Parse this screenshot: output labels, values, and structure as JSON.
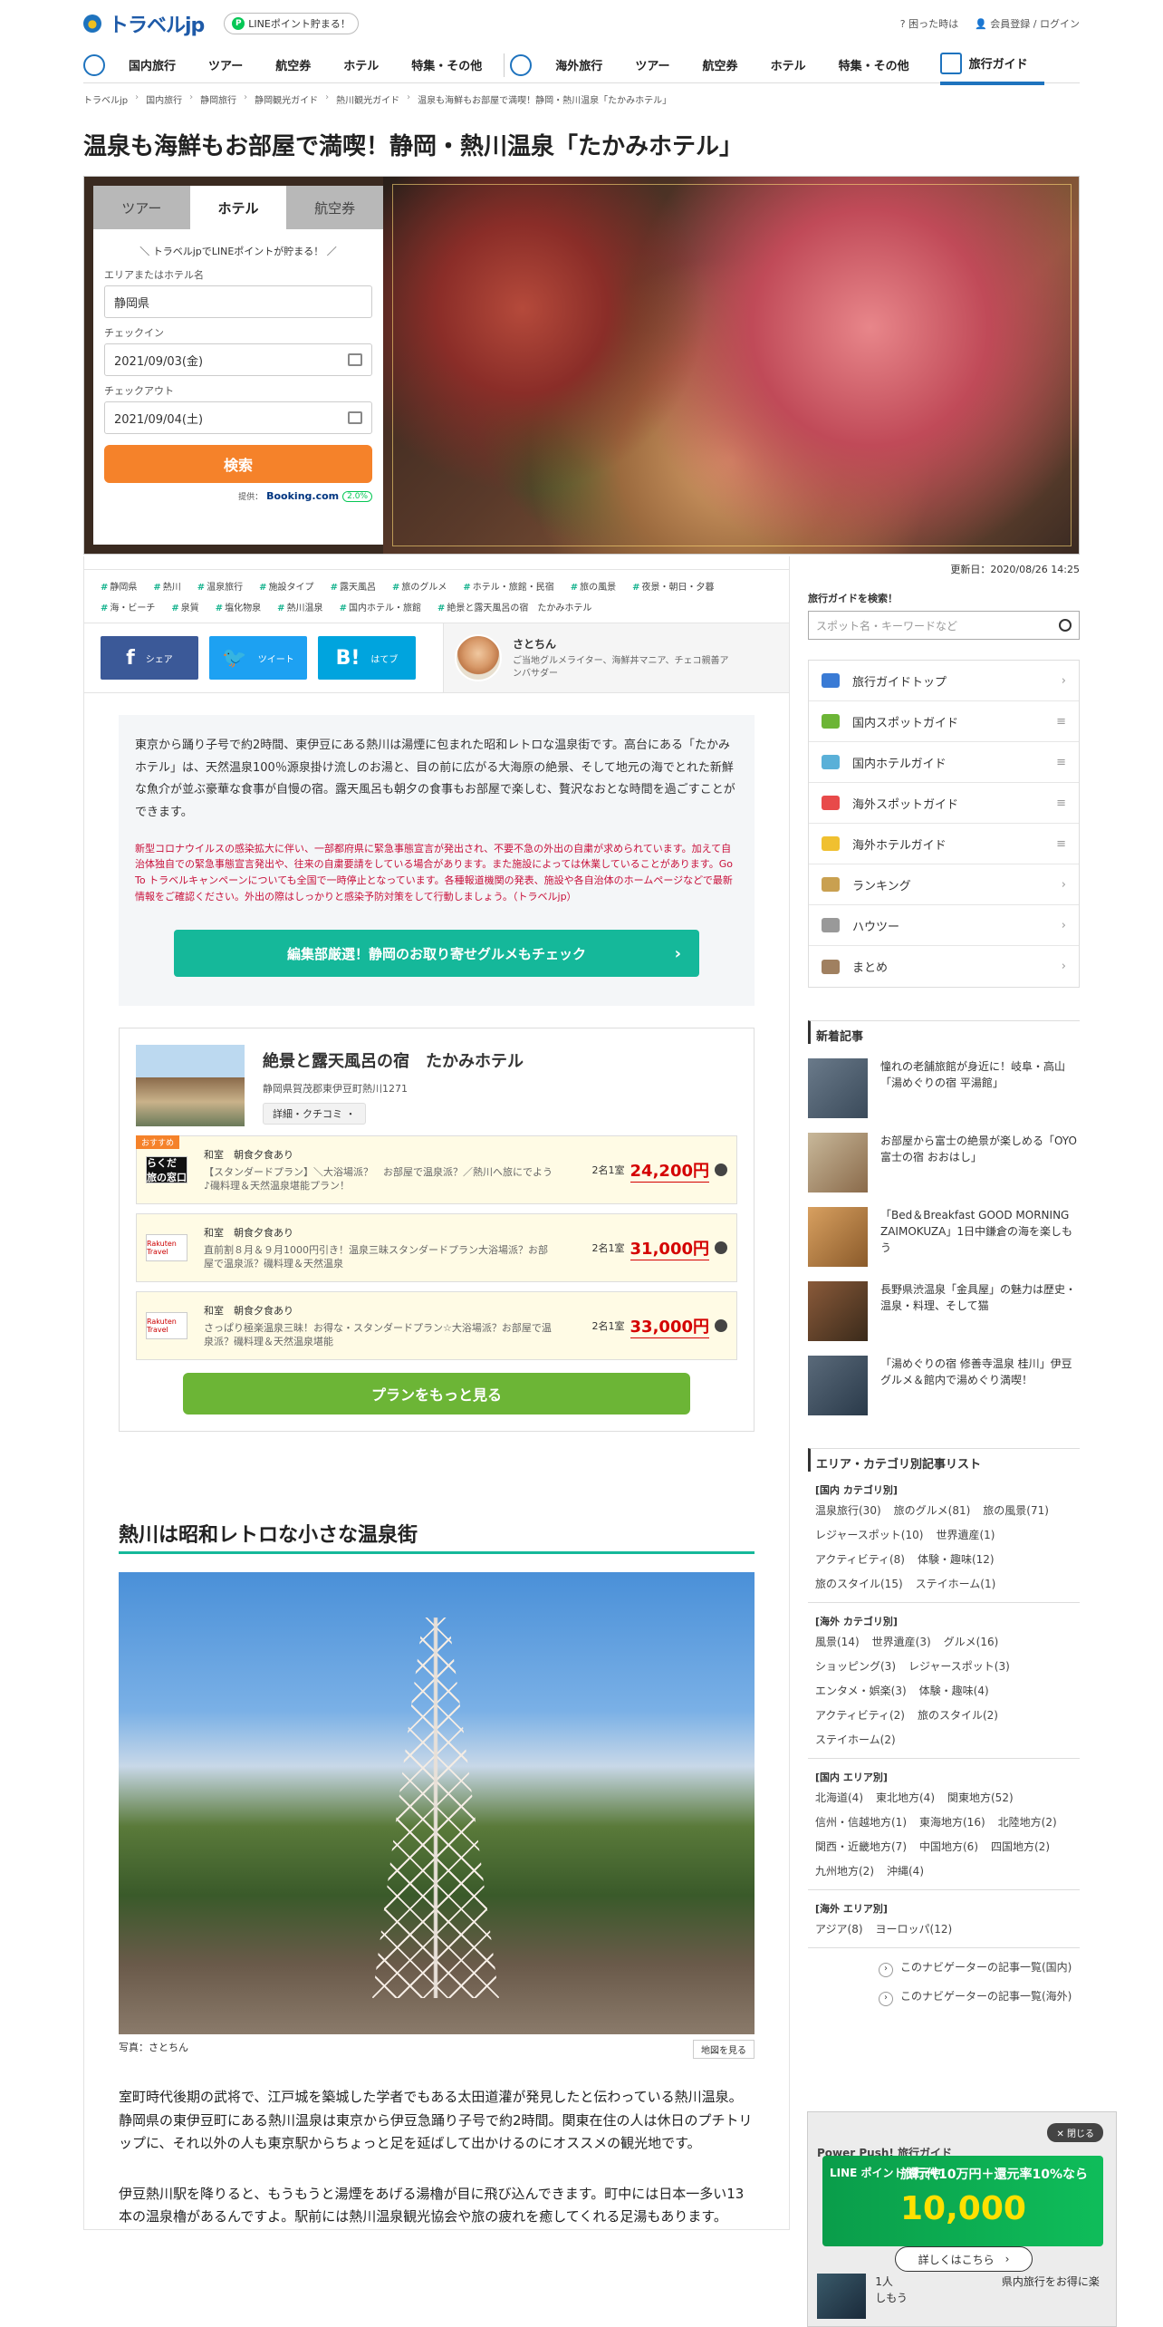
{
  "header": {
    "logo": "トラベルjp",
    "line_pill": "LINEポイント貯まる！",
    "help": "困った時は",
    "login": "会員登録 / ログイン"
  },
  "nav": {
    "domestic": [
      "国内旅行",
      "ツアー",
      "航空券",
      "ホテル",
      "特集・その他"
    ],
    "overseas": [
      "海外旅行",
      "ツアー",
      "航空券",
      "ホテル",
      "特集・その他"
    ],
    "guide": "旅行ガイド"
  },
  "breadcrumb": [
    "トラベルjp",
    "国内旅行",
    "静岡旅行",
    "静岡観光ガイド",
    "熱川観光ガイド",
    "温泉も海鮮もお部屋で満喫！静岡・熱川温泉「たかみホテル」"
  ],
  "title": "温泉も海鮮もお部屋で満喫！静岡・熱川温泉「たかみホテル」",
  "search_panel": {
    "tabs": [
      "ツアー",
      "ホテル",
      "航空券"
    ],
    "line_notice": "＼ トラベルjpでLINEポイントが貯まる！ ／",
    "area_label": "エリアまたはホテル名",
    "area_value": "静岡県",
    "checkin_label": "チェックイン",
    "checkin_value": "2021/09/03(金)",
    "checkout_label": "チェックアウト",
    "checkout_value": "2021/09/04(土)",
    "search_button": "検索",
    "provider": "提供：",
    "provider_name": "Booking.com",
    "point_rate": "2.0%"
  },
  "updated": "更新日：2020/08/26 14:25",
  "tags": [
    "静岡県",
    "熱川",
    "温泉旅行",
    "施設タイプ",
    "露天風呂",
    "旅のグルメ",
    "ホテル・旅館・民宿",
    "旅の風景",
    "夜景・朝日・夕暮",
    "海・ビーチ",
    "泉質",
    "塩化物泉",
    "熱川温泉",
    "国内ホテル・旅館",
    "絶景と露天風呂の宿　たかみホテル"
  ],
  "share": {
    "fb": "シェア",
    "tw": "ツイート",
    "hb": "はてブ",
    "author_name": "さとちん",
    "author_desc": "ご当地グルメライター、海鮮丼マニア、チェコ親善アンバサダー"
  },
  "lead": {
    "text": "東京から踊り子号で約2時間、東伊豆にある熱川は湯煙に包まれた昭和レトロな温泉街です。高台にある「たかみホテル」は、天然温泉100％源泉掛け流しのお湯と、目の前に広がる大海原の絶景、そして地元の海でとれた新鮮な魚介が並ぶ豪華な食事が自慢の宿。露天風呂も朝夕の食事もお部屋で楽しむ、贅沢なおとな時間を過ごすことができます。",
    "warning": "新型コロナウイルスの感染拡大に伴い、一部都府県に緊急事態宣言が発出され、不要不急の外出の自粛が求められています。加えて自治体独自での緊急事態宣言発出や、往来の自粛要請をしている場合があります。また施設によっては休業していることがあります。Go To トラベルキャンペーンについても全国で一時停止となっています。各種報道機関の発表、施設や各自治体のホームページなどで最新情報をご確認ください。外出の際はしっかりと感染予防対策をして行動しましょう。（トラベルjp）",
    "button": "編集部厳選！静岡のお取り寄せグルメもチェック"
  },
  "hotel": {
    "name": "絶景と露天風呂の宿　たかみホテル",
    "address": "静岡県賀茂郡東伊豆町熱川1271",
    "detail_button": "詳細・クチコミ ・",
    "recommend": "おすすめ",
    "plans": [
      {
        "logo": "らくだ 旅の窓口",
        "type": "和室　朝食夕食あり",
        "desc": "【スタンダードプラン】＼大浴場派？　お部屋で温泉派？／熱川へ旅にでよう♪磯料理＆天然温泉堪能プラン！",
        "unit": "2名1室",
        "price": "24,200円"
      },
      {
        "logo": "Rakuten Travel",
        "type": "和室　朝食夕食あり",
        "desc": "直前割８月＆９月1000円引き！温泉三昧スタンダードプラン大浴場派？お部屋で温泉派？磯料理＆天然温泉",
        "unit": "2名1室",
        "price": "31,000円"
      },
      {
        "logo": "Rakuten Travel",
        "type": "和室　朝食夕食あり",
        "desc": "さっぱり極楽温泉三昧！お得な・スタンダードプラン☆大浴場派？お部屋で温泉派？磯料理＆天然温泉堪能",
        "unit": "2名1室",
        "price": "33,000円"
      }
    ],
    "more_button": "プランをもっと見る"
  },
  "section": {
    "heading": "熱川は昭和レトロな小さな温泉街",
    "photo_credit": "写真：さとちん",
    "map_button": "地図を見る",
    "p1": "室町時代後期の武将で、江戸城を築城した学者でもある太田道灌が発見したと伝わっている熱川温泉。静岡県の東伊豆町にある熱川温泉は東京から伊豆急踊り子号で約2時間。関東在住の人は休日のプチトリップに、それ以外の人も東京駅からちょっと足を延ばして出かけるのにオススメの観光地です。",
    "p2": "伊豆熱川駅を降りると、もうもうと湯煙をあげる湯櫓が目に飛び込んできます。町中には日本一多い13本の温泉櫓があるんですよ。駅前には熱川温泉観光協会や旅の疲れを癒してくれる足湯もあります。"
  },
  "sidebar": {
    "search_title": "旅行ガイドを検索！",
    "search_placeholder": "スポット名・キーワードなど",
    "menu": [
      "旅行ガイドトップ",
      "国内スポットガイド",
      "国内ホテルガイド",
      "海外スポットガイド",
      "海外ホテルガイド",
      "ランキング",
      "ハウツー",
      "まとめ"
    ],
    "new_title": "新着記事",
    "news": [
      "憧れの老舗旅館が身近に！岐阜・高山「湯めぐりの宿 平湯館」",
      "お部屋から富士の絶景が楽しめる「OYO 富士の宿 おおはし」",
      "「Bed＆Breakfast GOOD MORNING ZAIMOKUZA」1日中鎌倉の海を楽しもう",
      "長野県渋温泉「金具屋」の魅力は歴史・温泉・料理、そして猫",
      "「湯めぐりの宿 修善寺温泉 桂川」伊豆グルメ＆館内で湯めぐり満喫！"
    ],
    "cat_title": "エリア・カテゴリ別記事リスト",
    "cats": [
      {
        "head": "[国内 カテゴリ別]",
        "items": [
          "温泉旅行(30)",
          "旅のグルメ(81)",
          "旅の風景(71)",
          "レジャースポット(10)",
          "世界遺産(1)",
          "アクティビティ(8)",
          "体験・趣味(12)",
          "旅のスタイル(15)",
          "ステイホーム(1)"
        ]
      },
      {
        "head": "[海外 カテゴリ別]",
        "items": [
          "風景(14)",
          "世界遺産(3)",
          "グルメ(16)",
          "ショッピング(3)",
          "レジャースポット(3)",
          "エンタメ・娯楽(3)",
          "体験・趣味(4)",
          "アクティビティ(2)",
          "旅のスタイル(2)",
          "ステイホーム(2)"
        ]
      },
      {
        "head": "[国内 エリア別]",
        "items": [
          "北海道(4)",
          "東北地方(4)",
          "関東地方(52)",
          "信州・信越地方(1)",
          "東海地方(16)",
          "北陸地方(2)",
          "関西・近畿地方(7)",
          "中国地方(6)",
          "四国地方(2)",
          "九州地方(2)",
          "沖縄(4)"
        ]
      },
      {
        "head": "[海外 エリア別]",
        "items": [
          "アジア(8)",
          "ヨーロッパ(12)"
        ]
      }
    ],
    "nav_links": [
      "このナビゲーターの記事一覧(国内)",
      "このナビゲーターの記事一覧(海外)"
    ]
  },
  "float_banner": {
    "close": "閉じる",
    "powerpush": "Power Push! 旅行ガイド",
    "line_label": "LINE ポイント 還元中!",
    "headline": "旅行代10万円＋還元率10%なら",
    "amount": "10,000",
    "more": "詳しくはこちら",
    "item_text": "1人　　　　　　　　　　県内旅行をお得に楽しもう"
  }
}
